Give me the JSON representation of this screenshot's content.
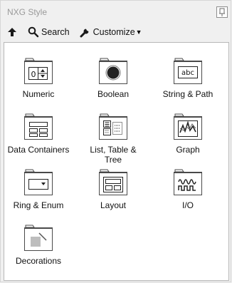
{
  "window": {
    "title": "NXG Style"
  },
  "toolbar": {
    "search_label": "Search",
    "customize_label": "Customize"
  },
  "palette": {
    "items": [
      {
        "label": "Numeric",
        "icon": "numeric-icon"
      },
      {
        "label": "Boolean",
        "icon": "boolean-icon"
      },
      {
        "label": "String & Path",
        "icon": "string-path-icon"
      },
      {
        "label": "Data Containers",
        "icon": "data-containers-icon"
      },
      {
        "label": "List, Table &\nTree",
        "icon": "list-table-tree-icon"
      },
      {
        "label": "Graph",
        "icon": "graph-icon"
      },
      {
        "label": "Ring & Enum",
        "icon": "ring-enum-icon"
      },
      {
        "label": "Layout",
        "icon": "layout-icon"
      },
      {
        "label": "I/O",
        "icon": "io-icon"
      },
      {
        "label": "Decorations",
        "icon": "decorations-icon"
      }
    ]
  },
  "numeric_icon_text": "0",
  "string_icon_text": "abc"
}
